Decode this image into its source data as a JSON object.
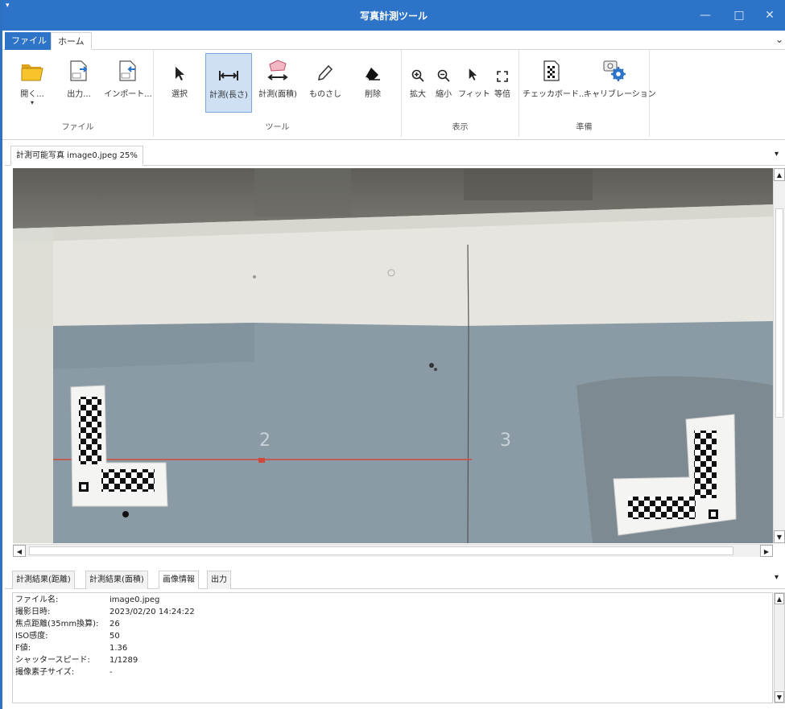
{
  "window": {
    "title": "写真計測ツール",
    "system_menu_glyph": "▾",
    "minimize_glyph": "—",
    "maximize_glyph": "□",
    "close_glyph": "✕",
    "accent_color": "#2d73c7"
  },
  "ribbon_tabs": [
    {
      "label": "ファイル",
      "active": false
    },
    {
      "label": "ホーム",
      "active": true
    }
  ],
  "ribbon_collapse_glyph": "⌄",
  "ribbon": {
    "file_group": {
      "label": "ファイル",
      "buttons": [
        {
          "label": "開く...",
          "icon": "folder-open-icon",
          "dropdown_glyph": "▾"
        },
        {
          "label": "出力...",
          "icon": "export-icon"
        },
        {
          "label": "インポート...",
          "icon": "import-icon"
        }
      ]
    },
    "tool_group": {
      "label": "ツール",
      "buttons": [
        {
          "label": "選択",
          "icon": "cursor-icon"
        },
        {
          "label": "計測(長さ)",
          "icon": "measure-length-icon",
          "active": true
        },
        {
          "label": "計測(面積)",
          "icon": "measure-area-icon"
        },
        {
          "label": "ものさし",
          "icon": "ruler-pencil-icon"
        },
        {
          "label": "削除",
          "icon": "eraser-icon"
        }
      ]
    },
    "view_group": {
      "label": "表示",
      "buttons": [
        {
          "label": "拡大",
          "icon": "zoom-in-icon"
        },
        {
          "label": "縮小",
          "icon": "zoom-out-icon"
        },
        {
          "label": "フィット",
          "icon": "fit-cursor-icon"
        },
        {
          "label": "等倍",
          "icon": "actual-size-icon"
        }
      ]
    },
    "prep_group": {
      "label": "準備",
      "buttons": [
        {
          "label": "チェッカボード...",
          "icon": "checkerboard-icon"
        },
        {
          "label": "キャリブレーション",
          "icon": "calibration-gear-icon"
        }
      ]
    }
  },
  "document_tab": {
    "label": "計測可能写真 image0.jpeg 25%",
    "pin_glyph": "▾"
  },
  "bottom_tabs": [
    {
      "label": "計測結果(距離)",
      "selected": false
    },
    {
      "label": "計測結果(面積)",
      "selected": false
    },
    {
      "label": "画像情報",
      "selected": true
    },
    {
      "label": "出力",
      "selected": false
    }
  ],
  "bottom_pin_glyph": "▾",
  "image_info": [
    {
      "key": "ファイル名:",
      "value": "image0.jpeg"
    },
    {
      "key": "撮影日時:",
      "value": "2023/02/20 14:24:22"
    },
    {
      "key": "焦点距離(35mm換算):",
      "value": "26"
    },
    {
      "key": "ISO感度:",
      "value": "50"
    },
    {
      "key": "F値:",
      "value": "1.36"
    },
    {
      "key": "シャッタースピード:",
      "value": "1/1289"
    },
    {
      "key": "撮像素子サイズ:",
      "value": "-"
    }
  ],
  "photo": {
    "chalk_marks": [
      "2",
      "3"
    ],
    "measure_line_color": "#d04a3a"
  },
  "scroll_glyphs": {
    "up": "▲",
    "down": "▼",
    "left": "◀",
    "right": "▶"
  }
}
